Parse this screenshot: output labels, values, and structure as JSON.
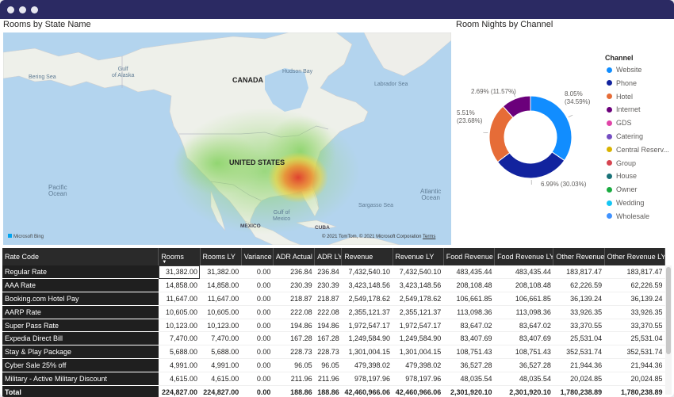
{
  "window": {
    "controls": [
      "close",
      "minimize",
      "maximize"
    ]
  },
  "map_visual": {
    "title": "Rooms by State Name",
    "labels": {
      "canada": "CANADA",
      "usa": "UNITED STATES",
      "mexico": "MEXICO",
      "cuba": "CUBA",
      "bering": "Bering Sea",
      "alaska_gulf": "Gulf\nof Alaska",
      "hudson": "Hudson Bay",
      "labrador": "Labrador Sea",
      "pacific": "Pacific\nOcean",
      "atlantic": "Atlantic\nOcean",
      "mexico_gulf": "Gulf of\nMexico",
      "sargasso": "Sargasso Sea"
    },
    "bing": "Microsoft Bing",
    "attribution": "© 2021 TomTom, © 2021 Microsoft Corporation",
    "terms": "Terms"
  },
  "pie_visual": {
    "title": "Room Nights by Channel",
    "slice_labels": {
      "website": "8.05%\n(34.59%)",
      "phone": "6.99% (30.03%)",
      "hotel": "5.51%\n(23.68%)",
      "internet": "2.69% (11.57%)"
    },
    "legend_title": "Channel",
    "legend": [
      {
        "name": "Website",
        "color": "#118DFF"
      },
      {
        "name": "Phone",
        "color": "#12239E"
      },
      {
        "name": "Hotel",
        "color": "#E66C37"
      },
      {
        "name": "Internet",
        "color": "#6B007B"
      },
      {
        "name": "GDS",
        "color": "#E044A7"
      },
      {
        "name": "Catering",
        "color": "#744EC2"
      },
      {
        "name": "Central Reserv...",
        "color": "#D9B300"
      },
      {
        "name": "Group",
        "color": "#D64550"
      },
      {
        "name": "House",
        "color": "#197278"
      },
      {
        "name": "Owner",
        "color": "#1AAB40"
      },
      {
        "name": "Wedding",
        "color": "#15C6F4"
      },
      {
        "name": "Wholesale",
        "color": "#4092FF"
      }
    ]
  },
  "chart_data": {
    "type": "pie",
    "title": "Room Nights by Channel",
    "categories": [
      "Website",
      "Phone",
      "Hotel",
      "Internet"
    ],
    "values": [
      8.05,
      6.99,
      5.51,
      2.69
    ],
    "percent_of_total": [
      34.59,
      30.03,
      23.68,
      11.57
    ],
    "legend_placement": "right"
  },
  "table": {
    "headers": [
      "Rate Code",
      "Rooms",
      "Rooms LY",
      "Variance",
      "ADR Actual",
      "ADR LY",
      "Revenue",
      "Revenue LY",
      "Food Revenue",
      "Food Revenue LY",
      "Other Revenue",
      "Other Revenue LY"
    ],
    "rows": [
      [
        "Regular Rate",
        "31,382.00",
        "31,382.00",
        "0.00",
        "236.84",
        "236.84",
        "7,432,540.10",
        "7,432,540.10",
        "483,435.44",
        "483,435.44",
        "183,817.47",
        "183,817.47"
      ],
      [
        "AAA Rate",
        "14,858.00",
        "14,858.00",
        "0.00",
        "230.39",
        "230.39",
        "3,423,148.56",
        "3,423,148.56",
        "208,108.48",
        "208,108.48",
        "62,226.59",
        "62,226.59"
      ],
      [
        "Booking.com Hotel Pay",
        "11,647.00",
        "11,647.00",
        "0.00",
        "218.87",
        "218.87",
        "2,549,178.62",
        "2,549,178.62",
        "106,661.85",
        "106,661.85",
        "36,139.24",
        "36,139.24"
      ],
      [
        "AARP Rate",
        "10,605.00",
        "10,605.00",
        "0.00",
        "222.08",
        "222.08",
        "2,355,121.37",
        "2,355,121.37",
        "113,098.36",
        "113,098.36",
        "33,926.35",
        "33,926.35"
      ],
      [
        "Super Pass Rate",
        "10,123.00",
        "10,123.00",
        "0.00",
        "194.86",
        "194.86",
        "1,972,547.17",
        "1,972,547.17",
        "83,647.02",
        "83,647.02",
        "33,370.55",
        "33,370.55"
      ],
      [
        "Expedia Direct Bill",
        "7,470.00",
        "7,470.00",
        "0.00",
        "167.28",
        "167.28",
        "1,249,584.90",
        "1,249,584.90",
        "83,407.69",
        "83,407.69",
        "25,531.04",
        "25,531.04"
      ],
      [
        "Stay & Play Package",
        "5,688.00",
        "5,688.00",
        "0.00",
        "228.73",
        "228.73",
        "1,301,004.15",
        "1,301,004.15",
        "108,751.43",
        "108,751.43",
        "352,531.74",
        "352,531.74"
      ],
      [
        "Cyber Sale 25% off",
        "4,991.00",
        "4,991.00",
        "0.00",
        "96.05",
        "96.05",
        "479,398.02",
        "479,398.02",
        "36,527.28",
        "36,527.28",
        "21,944.36",
        "21,944.36"
      ],
      [
        "Military - Active Military Discount",
        "4,615.00",
        "4,615.00",
        "0.00",
        "211.96",
        "211.96",
        "978,197.96",
        "978,197.96",
        "48,035.54",
        "48,035.54",
        "20,024.85",
        "20,024.85"
      ]
    ],
    "total": [
      "Total",
      "224,827.00",
      "224,827.00",
      "0.00",
      "188.86",
      "188.86",
      "42,460,966.06",
      "42,460,966.06",
      "2,301,920.10",
      "2,301,920.10",
      "1,780,238.89",
      "1,780,238.89"
    ]
  }
}
